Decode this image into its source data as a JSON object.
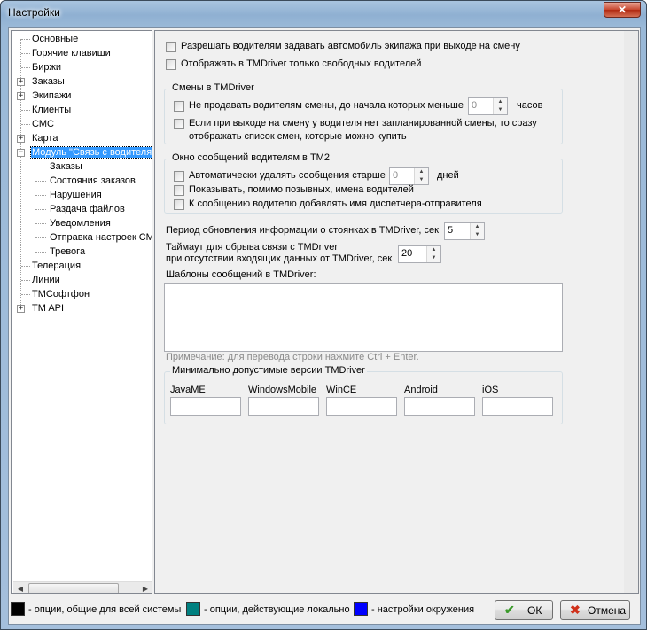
{
  "window": {
    "title": "Настройки",
    "close_glyph": "✕"
  },
  "tree": {
    "items": [
      {
        "label": "Основные"
      },
      {
        "label": "Горячие клавиши"
      },
      {
        "label": "Биржи"
      },
      {
        "label": "Заказы"
      },
      {
        "label": "Экипажи"
      },
      {
        "label": "Клиенты"
      },
      {
        "label": "СМС"
      },
      {
        "label": "Карта"
      },
      {
        "label": "Модуль \"Связь с водителями\""
      },
      {
        "label": "Заказы"
      },
      {
        "label": "Состояния заказов"
      },
      {
        "label": "Нарушения"
      },
      {
        "label": "Раздача файлов"
      },
      {
        "label": "Уведомления"
      },
      {
        "label": "Отправка настроек СМС"
      },
      {
        "label": "Тревога"
      },
      {
        "label": "Телерация"
      },
      {
        "label": "Линии"
      },
      {
        "label": "ТМСофтфон"
      },
      {
        "label": "TM API"
      }
    ],
    "selected_label": "Модуль \"Связь с водителями\"",
    "expander_plus": "+",
    "expander_minus": "−",
    "scroll_left": "◀",
    "scroll_right": "▶"
  },
  "settings": {
    "allow_set_car": "Разрешать водителям задавать автомобиль экипажа при выходе на смену",
    "show_free_only": "Отображать в TMDriver только свободных водителей",
    "shifts_group": {
      "title": "Смены в TMDriver",
      "no_sell_label": "Не продавать водителям смены, до начала которых меньше",
      "no_sell_value": "0",
      "no_sell_unit": "часов",
      "show_list_line1": "Если при выходе на смену у водителя нет запланированной смены, то сразу",
      "show_list_line2": "отображать список смен, которые можно купить"
    },
    "messages_group": {
      "title": "Окно сообщений водителям в ТМ2",
      "auto_delete_label": "Автоматически удалять сообщения старше",
      "auto_delete_value": "0",
      "auto_delete_unit": "дней",
      "show_names": "Показывать, помимо позывных, имена водителей",
      "add_dispatcher": "К сообщению водителю добавлять имя диспетчера-отправителя"
    },
    "refresh_period_label": "Период обновления информации о стоянках в TMDriver, сек",
    "refresh_period_value": "5",
    "timeout_line1": "Таймаут для обрыва связи с TMDriver",
    "timeout_line2": "при отсутствии входящих данных от TMDriver, сек",
    "timeout_value": "20",
    "templates_label": "Шаблоны сообщений в TMDriver:",
    "templates_note": "Примечание: для перевода строки нажмите Ctrl + Enter.",
    "versions_group": {
      "title": "Минимально допустимые версии TMDriver",
      "platforms": [
        {
          "label": "JavaME",
          "value": ""
        },
        {
          "label": "WindowsMobile",
          "value": ""
        },
        {
          "label": "WinCE",
          "value": ""
        },
        {
          "label": "Android",
          "value": ""
        },
        {
          "label": "iOS",
          "value": ""
        }
      ]
    }
  },
  "spin_up": "▲",
  "spin_down": "▼",
  "footer": {
    "legend": [
      {
        "color": "#000000",
        "label": "- опции, общие для всей системы"
      },
      {
        "color": "#008080",
        "label": "- опции, действующие локально"
      },
      {
        "color": "#0000ff",
        "label": "- настройки окружения"
      }
    ],
    "ok_label": "ОК",
    "ok_icon": "✔",
    "cancel_label": "Отмена",
    "cancel_icon": "✖"
  },
  "icons": {
    "ok": "check-icon",
    "cancel": "cross-icon",
    "close": "close-icon"
  }
}
